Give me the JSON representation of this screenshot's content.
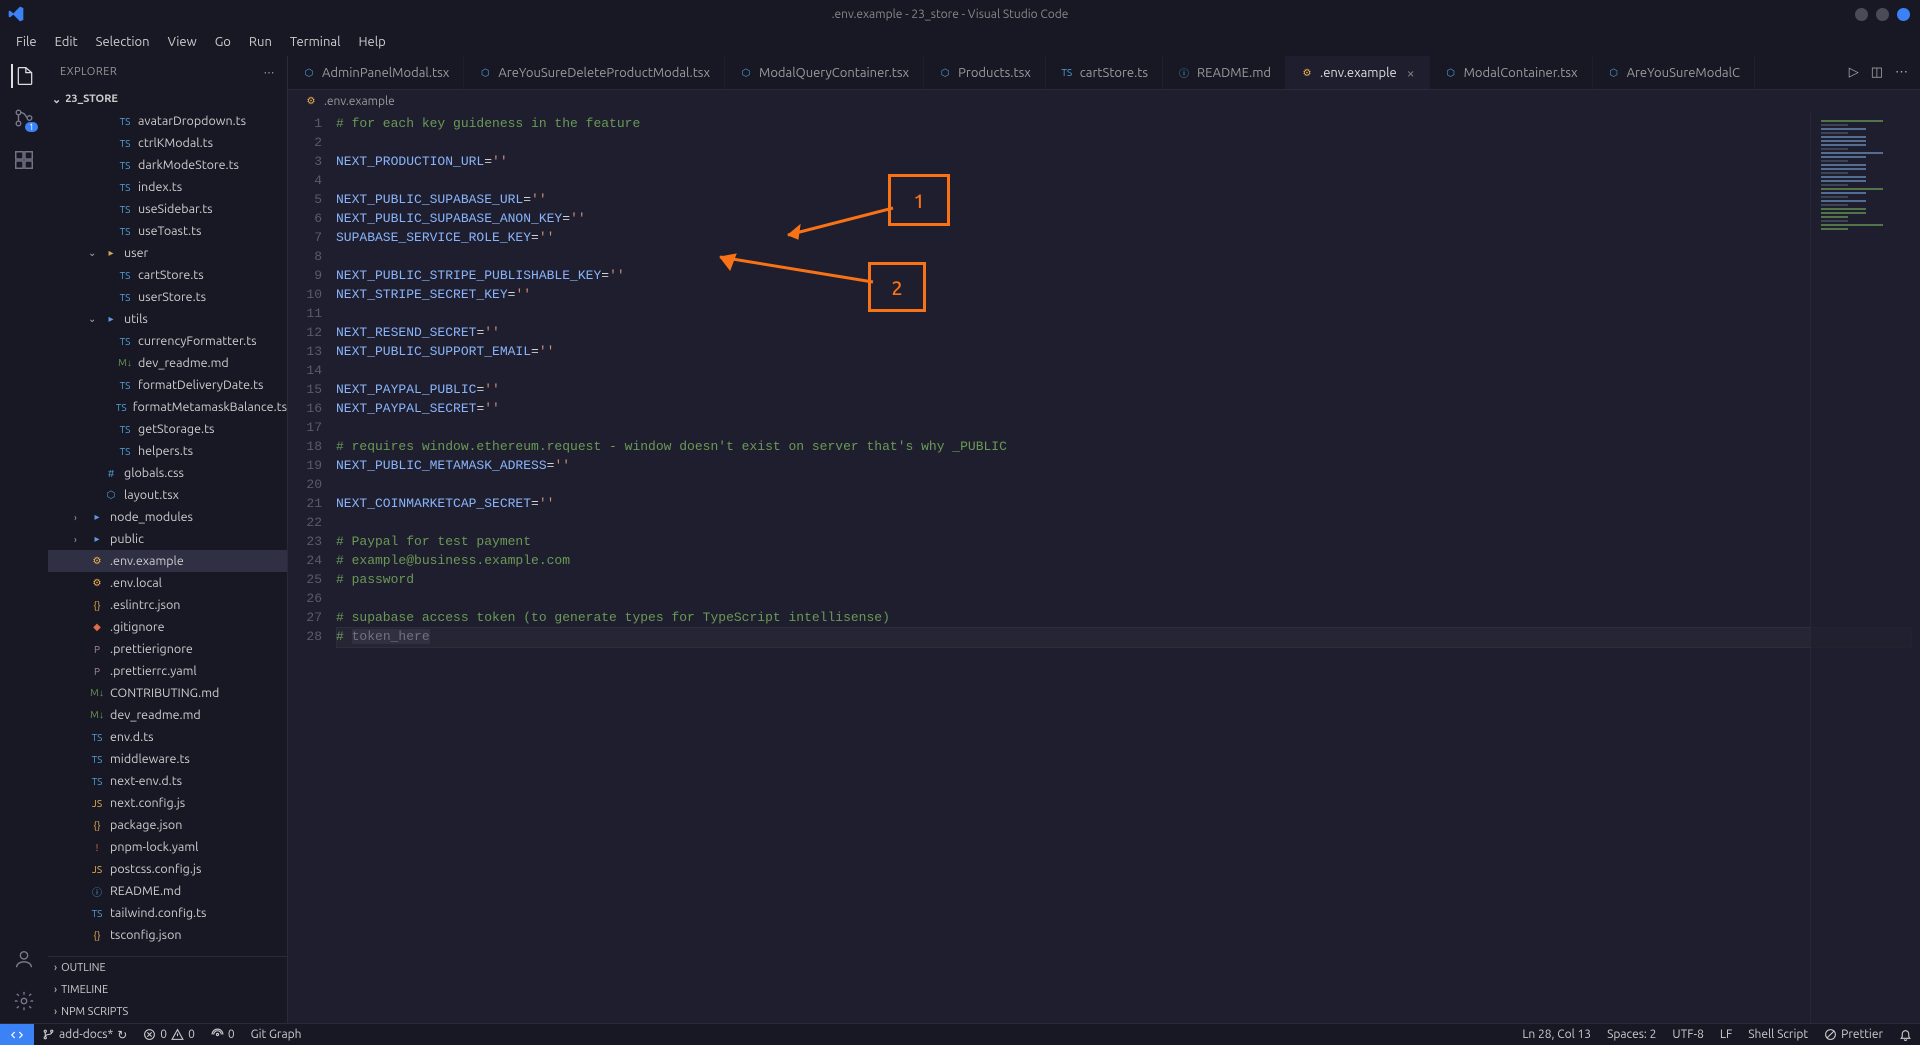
{
  "titlebar": {
    "title": ".env.example - 23_store - Visual Studio Code"
  },
  "menubar": [
    "File",
    "Edit",
    "Selection",
    "View",
    "Go",
    "Run",
    "Terminal",
    "Help"
  ],
  "activitybar": {
    "scm_badge": "1"
  },
  "sidebar": {
    "header": "EXPLORER",
    "root": "23_STORE",
    "tree": [
      {
        "type": "file",
        "name": "avatarDropdown.ts",
        "icon": "ts",
        "indent": 3
      },
      {
        "type": "file",
        "name": "ctrlKModal.ts",
        "icon": "ts",
        "indent": 3
      },
      {
        "type": "file",
        "name": "darkModeStore.ts",
        "icon": "ts",
        "indent": 3
      },
      {
        "type": "file",
        "name": "index.ts",
        "icon": "ts",
        "indent": 3
      },
      {
        "type": "file",
        "name": "useSidebar.ts",
        "icon": "ts",
        "indent": 3
      },
      {
        "type": "file",
        "name": "useToast.ts",
        "icon": "ts",
        "indent": 3
      },
      {
        "type": "folder",
        "name": "user",
        "open": true,
        "indent": 2
      },
      {
        "type": "file",
        "name": "cartStore.ts",
        "icon": "ts",
        "indent": 3
      },
      {
        "type": "file",
        "name": "userStore.ts",
        "icon": "ts",
        "indent": 3
      },
      {
        "type": "folder",
        "name": "utils",
        "open": true,
        "indent": 2,
        "folderColor": "blue"
      },
      {
        "type": "file",
        "name": "currencyFormatter.ts",
        "icon": "ts",
        "indent": 3
      },
      {
        "type": "file",
        "name": "dev_readme.md",
        "icon": "md",
        "indent": 3
      },
      {
        "type": "file",
        "name": "formatDeliveryDate.ts",
        "icon": "ts",
        "indent": 3
      },
      {
        "type": "file",
        "name": "formatMetamaskBalance.ts",
        "icon": "ts",
        "indent": 3
      },
      {
        "type": "file",
        "name": "getStorage.ts",
        "icon": "ts",
        "indent": 3
      },
      {
        "type": "file",
        "name": "helpers.ts",
        "icon": "ts",
        "indent": 3
      },
      {
        "type": "file",
        "name": "globals.css",
        "icon": "css",
        "indent": 2
      },
      {
        "type": "file",
        "name": "layout.tsx",
        "icon": "react",
        "indent": 2
      },
      {
        "type": "folder",
        "name": "node_modules",
        "open": false,
        "indent": 1,
        "folderColor": "blue"
      },
      {
        "type": "folder",
        "name": "public",
        "open": false,
        "indent": 1,
        "folderColor": "blue"
      },
      {
        "type": "file",
        "name": ".env.example",
        "icon": "env",
        "indent": 1,
        "selected": true
      },
      {
        "type": "file",
        "name": ".env.local",
        "icon": "env",
        "indent": 1
      },
      {
        "type": "file",
        "name": ".eslintrc.json",
        "icon": "json",
        "indent": 1
      },
      {
        "type": "file",
        "name": ".gitignore",
        "icon": "git",
        "indent": 1
      },
      {
        "type": "file",
        "name": ".prettierignore",
        "icon": "prettier",
        "indent": 1
      },
      {
        "type": "file",
        "name": ".prettierrc.yaml",
        "icon": "prettier",
        "indent": 1
      },
      {
        "type": "file",
        "name": "CONTRIBUTING.md",
        "icon": "md",
        "indent": 1
      },
      {
        "type": "file",
        "name": "dev_readme.md",
        "icon": "md",
        "indent": 1
      },
      {
        "type": "file",
        "name": "env.d.ts",
        "icon": "ts",
        "indent": 1
      },
      {
        "type": "file",
        "name": "middleware.ts",
        "icon": "ts",
        "indent": 1
      },
      {
        "type": "file",
        "name": "next-env.d.ts",
        "icon": "ts",
        "indent": 1
      },
      {
        "type": "file",
        "name": "next.config.js",
        "icon": "js",
        "indent": 1
      },
      {
        "type": "file",
        "name": "package.json",
        "icon": "json",
        "indent": 1
      },
      {
        "type": "file",
        "name": "pnpm-lock.yaml",
        "icon": "yaml",
        "indent": 1
      },
      {
        "type": "file",
        "name": "postcss.config.js",
        "icon": "js",
        "indent": 1
      },
      {
        "type": "file",
        "name": "README.md",
        "icon": "info",
        "indent": 1
      },
      {
        "type": "file",
        "name": "tailwind.config.ts",
        "icon": "ts",
        "indent": 1
      },
      {
        "type": "file",
        "name": "tsconfig.json",
        "icon": "json",
        "indent": 1
      }
    ],
    "outline": "OUTLINE",
    "timeline": "TIMELINE",
    "npm": "NPM SCRIPTS"
  },
  "tabs": [
    {
      "label": "AdminPanelModal.tsx",
      "icon": "react"
    },
    {
      "label": "AreYouSureDeleteProductModal.tsx",
      "icon": "react"
    },
    {
      "label": "ModalQueryContainer.tsx",
      "icon": "react"
    },
    {
      "label": "Products.tsx",
      "icon": "react"
    },
    {
      "label": "cartStore.ts",
      "icon": "ts"
    },
    {
      "label": "README.md",
      "icon": "info"
    },
    {
      "label": ".env.example",
      "icon": "env",
      "active": true,
      "close": true
    },
    {
      "label": "ModalContainer.tsx",
      "icon": "react"
    },
    {
      "label": "AreYouSureModalC",
      "icon": "react"
    }
  ],
  "breadcrumb": ".env.example",
  "code": {
    "lines": [
      {
        "n": 1,
        "t": "# for each key guideness in the feature",
        "cls": "c"
      },
      {
        "n": 2,
        "t": "",
        "cls": ""
      },
      {
        "n": 3,
        "t": "NEXT_PRODUCTION_URL=''",
        "cls": "kv"
      },
      {
        "n": 4,
        "t": "",
        "cls": ""
      },
      {
        "n": 5,
        "t": "NEXT_PUBLIC_SUPABASE_URL=''",
        "cls": "kv"
      },
      {
        "n": 6,
        "t": "NEXT_PUBLIC_SUPABASE_ANON_KEY=''",
        "cls": "kv"
      },
      {
        "n": 7,
        "t": "SUPABASE_SERVICE_ROLE_KEY=''",
        "cls": "kv"
      },
      {
        "n": 8,
        "t": "",
        "cls": ""
      },
      {
        "n": 9,
        "t": "NEXT_PUBLIC_STRIPE_PUBLISHABLE_KEY=''",
        "cls": "kv"
      },
      {
        "n": 10,
        "t": "NEXT_STRIPE_SECRET_KEY=''",
        "cls": "kv"
      },
      {
        "n": 11,
        "t": "",
        "cls": ""
      },
      {
        "n": 12,
        "t": "NEXT_RESEND_SECRET=''",
        "cls": "kv"
      },
      {
        "n": 13,
        "t": "NEXT_PUBLIC_SUPPORT_EMAIL=''",
        "cls": "kv"
      },
      {
        "n": 14,
        "t": "",
        "cls": ""
      },
      {
        "n": 15,
        "t": "NEXT_PAYPAL_PUBLIC=''",
        "cls": "kv"
      },
      {
        "n": 16,
        "t": "NEXT_PAYPAL_SECRET=''",
        "cls": "kv"
      },
      {
        "n": 17,
        "t": "",
        "cls": ""
      },
      {
        "n": 18,
        "t": "# requires window.ethereum.request - window doesn't exist on server that's why _PUBLIC",
        "cls": "c"
      },
      {
        "n": 19,
        "t": "NEXT_PUBLIC_METAMASK_ADRESS=''",
        "cls": "kv"
      },
      {
        "n": 20,
        "t": "",
        "cls": ""
      },
      {
        "n": 21,
        "t": "NEXT_COINMARKETCAP_SECRET=''",
        "cls": "kv"
      },
      {
        "n": 22,
        "t": "",
        "cls": ""
      },
      {
        "n": 23,
        "t": "# Paypal for test payment",
        "cls": "c"
      },
      {
        "n": 24,
        "t": "# example@business.example.com",
        "cls": "c"
      },
      {
        "n": 25,
        "t": "# password",
        "cls": "c"
      },
      {
        "n": 26,
        "t": "",
        "cls": ""
      },
      {
        "n": 27,
        "t": "# supabase access token (to generate types for TypeScript intellisense)",
        "cls": "c"
      },
      {
        "n": 28,
        "t": "# token_here",
        "cls": "c-dim",
        "cursor": true
      }
    ]
  },
  "annotations": {
    "box1": "1",
    "box2": "2"
  },
  "statusbar": {
    "branch": "add-docs*",
    "sync": "↻",
    "errors": "0",
    "warnings": "0",
    "ports": "0",
    "gitgraph": "Git Graph",
    "position": "Ln 28, Col 13",
    "spaces": "Spaces: 2",
    "encoding": "UTF-8",
    "eol": "LF",
    "lang": "Shell Script",
    "prettier": "Prettier"
  }
}
